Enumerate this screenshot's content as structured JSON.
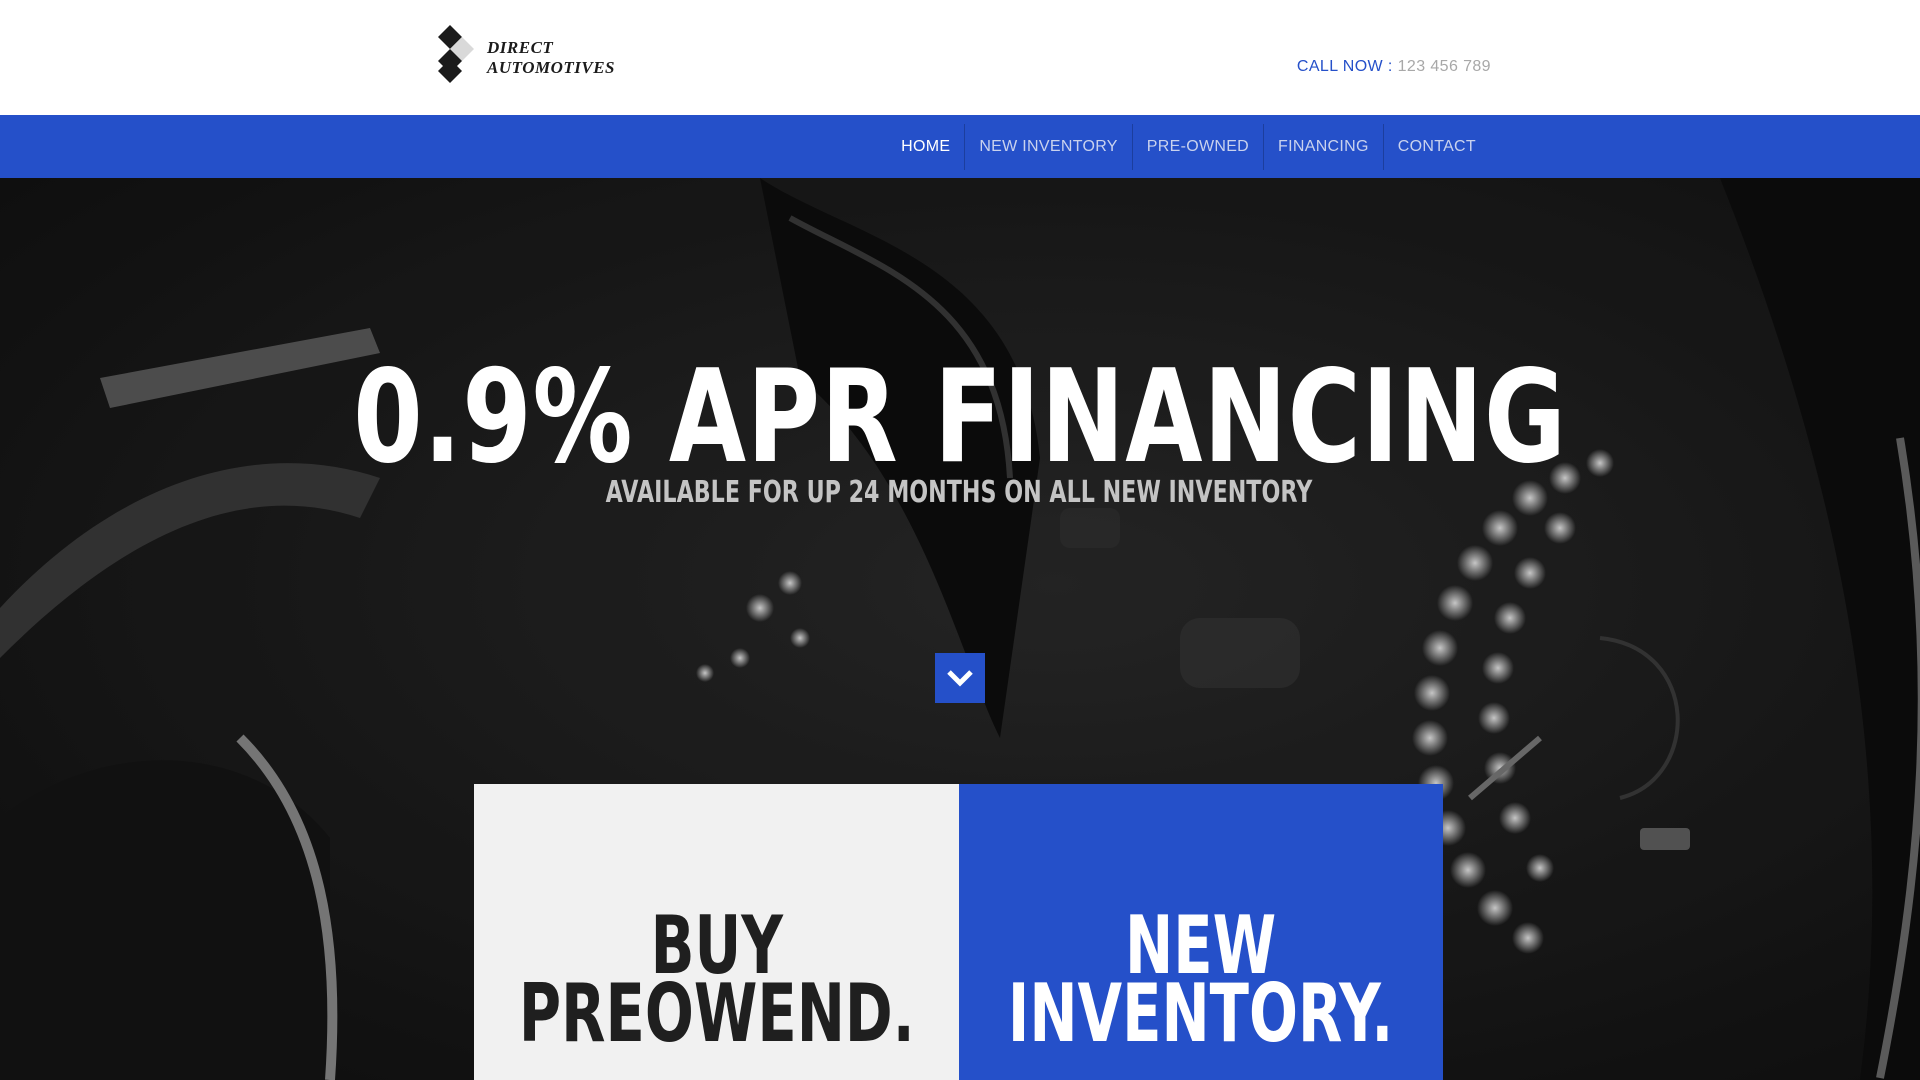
{
  "brand": {
    "line1": "DIRECT",
    "line2": "AUTOMOTIVES",
    "logo_icon": "diamond-logo-icon"
  },
  "contact": {
    "label": "CALL NOW :",
    "phone": "123 456 789"
  },
  "nav": {
    "items": [
      {
        "label": "HOME",
        "active": true
      },
      {
        "label": "NEW INVENTORY",
        "active": false
      },
      {
        "label": "PRE-OWNED",
        "active": false
      },
      {
        "label": "FINANCING",
        "active": false
      },
      {
        "label": "CONTACT",
        "active": false
      }
    ]
  },
  "hero": {
    "headline": "0.9% APR FINANCING",
    "subhead": "AVAILABLE FOR UP 24 MONTHS ON ALL NEW INVENTORY",
    "scroll_icon": "chevron-down-icon"
  },
  "cards": {
    "left": {
      "line1": "BUY",
      "line2": "PREOWEND."
    },
    "right": {
      "line1": "NEW",
      "line2": "INVENTORY."
    }
  },
  "colors": {
    "accent": "#2550c9",
    "header_bg": "#ffffff",
    "card_light": "#f1f1f1",
    "phone_gray": "#a8a8a8"
  }
}
